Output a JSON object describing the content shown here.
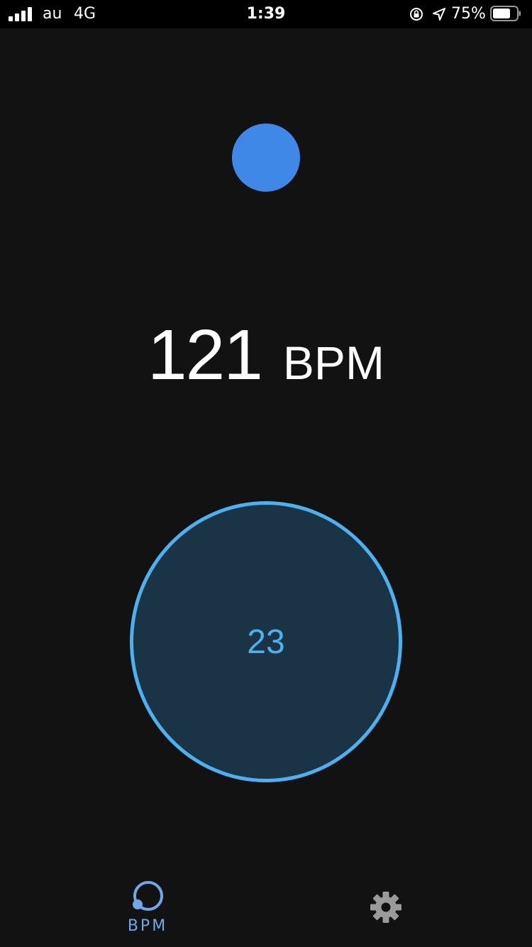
{
  "status_bar": {
    "carrier": "au",
    "network": "4G",
    "time": "1:39",
    "battery_percent": "75%",
    "battery_level": 0.75
  },
  "main": {
    "bpm_value": "121",
    "bpm_unit": "BPM",
    "tap_count": "23"
  },
  "tabs": [
    {
      "label": "BPM",
      "icon": "bpm-icon",
      "active": true
    },
    {
      "label": "",
      "icon": "gear-icon",
      "active": false
    }
  ],
  "colors": {
    "background": "#121212",
    "accent": "#4bb1f0",
    "beat_dot": "#4088e8",
    "tab_active": "#6fa8e8",
    "tab_inactive": "#9a9a9a"
  }
}
